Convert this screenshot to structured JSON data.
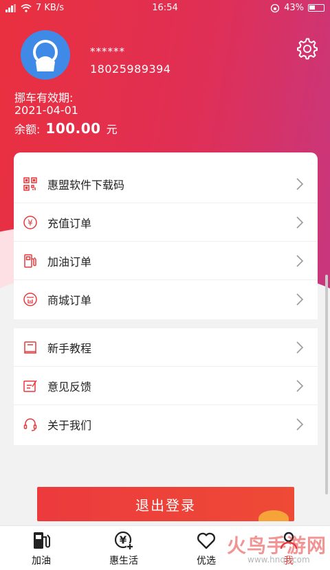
{
  "status_bar": {
    "net_speed": "7 KB/s",
    "time": "16:54",
    "battery": "43%"
  },
  "profile": {
    "nickname": "******",
    "phone": "18025989394",
    "validity_label": "挪车有效期:",
    "validity_date": "2021-04-01",
    "balance_label": "余额:",
    "balance_amount": "100.00",
    "balance_unit": "元"
  },
  "menu_group_1": [
    {
      "label": "惠盟软件下载码",
      "icon": "qrcode-icon"
    },
    {
      "label": "充值订单",
      "icon": "yuan-coin-icon"
    },
    {
      "label": "加油订单",
      "icon": "fuel-pump-icon"
    },
    {
      "label": "商城订单",
      "icon": "shop-coin-icon"
    }
  ],
  "menu_group_2": [
    {
      "label": "新手教程",
      "icon": "book-icon"
    },
    {
      "label": "意见反馈",
      "icon": "feedback-edit-icon"
    },
    {
      "label": "关于我们",
      "icon": "headset-icon"
    }
  ],
  "logout_label": "退出登录",
  "tabs": [
    {
      "label": "加油",
      "icon": "fuel-pump-icon",
      "active": false
    },
    {
      "label": "惠生活",
      "icon": "yuan-plus-icon",
      "active": false
    },
    {
      "label": "优选",
      "icon": "heart-icon",
      "active": false
    },
    {
      "label": "我",
      "icon": "user-icon",
      "active": true
    }
  ],
  "watermark": {
    "text": "火鸟手游网",
    "url": "www.hnqs.com"
  },
  "colors": {
    "header_start": "#e9303f",
    "header_end": "#c7377f",
    "accent": "#e5393c",
    "avatar": "#3f8ae6"
  }
}
